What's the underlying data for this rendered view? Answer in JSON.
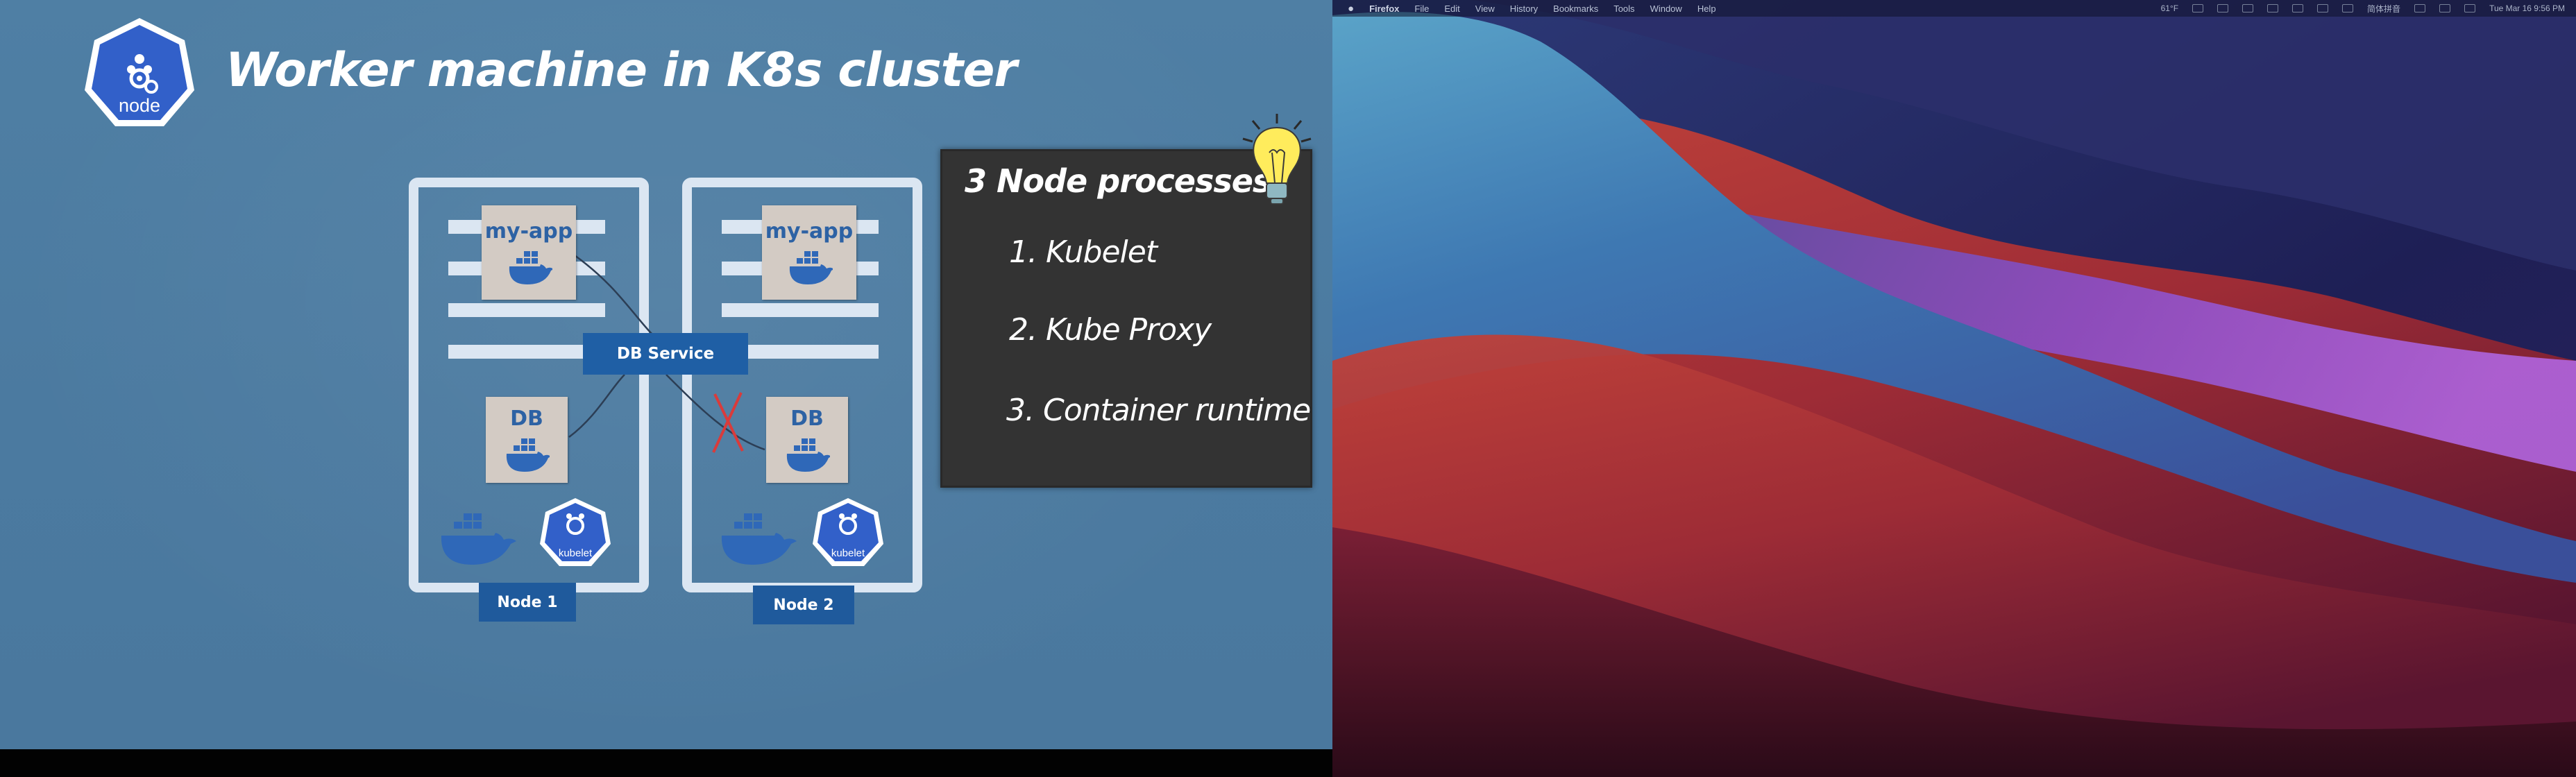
{
  "slide": {
    "title": "Worker machine in K8s cluster",
    "node_badge_label": "node",
    "kubelet_badge_label": "kubelet",
    "db_service_label": "DB Service",
    "nodes": [
      {
        "tag": "Node 1",
        "app_label": "my-app",
        "db_label": "DB"
      },
      {
        "tag": "Node 2",
        "app_label": "my-app",
        "db_label": "DB"
      }
    ],
    "blackboard": {
      "heading": "3 Node processes:",
      "items": [
        "1. Kubelet",
        "2. Kube Proxy",
        "3. Container runtime"
      ]
    },
    "colors": {
      "background": "#4b7aa0",
      "badge": "#2f5cc7",
      "tag": "#1f5a9c",
      "board": "#333333"
    }
  },
  "desktop": {
    "menu": {
      "apple_icon": "apple-icon",
      "app_name": "Firefox",
      "items": [
        "File",
        "Edit",
        "View",
        "History",
        "Bookmarks",
        "Tools",
        "Window",
        "Help"
      ],
      "status": {
        "temperature": "61°F",
        "input_method": "简体拼音",
        "datetime": "Tue Mar 16  9:56 PM"
      }
    }
  }
}
